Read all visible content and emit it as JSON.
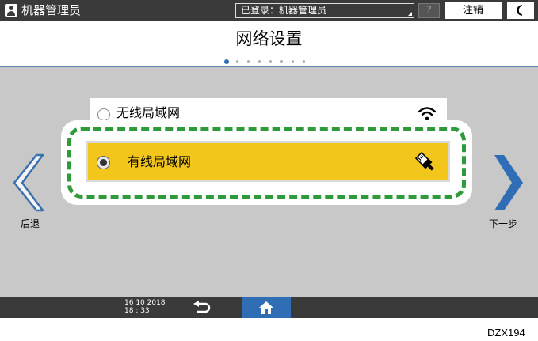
{
  "topbar": {
    "user_label": "机器管理员",
    "login_text": "已登录：机器管理员",
    "help_label": "?",
    "logout_label": "注销"
  },
  "title": {
    "text": "网络设置",
    "page_count": 8,
    "current_page": 1
  },
  "nav": {
    "back_label": "后退",
    "next_label": "下一步"
  },
  "options": [
    {
      "label": "无线局域网",
      "icon": "wifi-icon",
      "selected": false
    },
    {
      "label": "有线局域网",
      "icon": "lan-cable-icon",
      "selected": true
    }
  ],
  "bottombar": {
    "date": "16 10 2018",
    "time": "18 : 33"
  },
  "figure_id": "DZX194",
  "colors": {
    "accent_blue": "#2f6db5",
    "selected_yellow": "#f2c61b",
    "highlight_green": "#2f9a3a",
    "bar_dark": "#3a3a3a"
  }
}
